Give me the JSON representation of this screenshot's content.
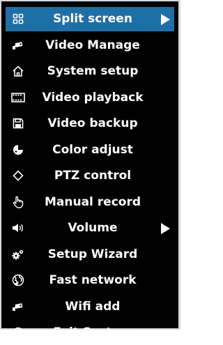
{
  "menu": {
    "selected_color": "#1f6fa7",
    "items": [
      {
        "label": "Split screen",
        "icon": "grid-icon",
        "submenu": true,
        "selected": true
      },
      {
        "label": "Video Manage",
        "icon": "camera-icon",
        "submenu": false,
        "selected": false
      },
      {
        "label": "System setup",
        "icon": "home-icon",
        "submenu": false,
        "selected": false
      },
      {
        "label": "Video playback",
        "icon": "film-icon",
        "submenu": false,
        "selected": false
      },
      {
        "label": "Video backup",
        "icon": "floppy-disk-icon",
        "submenu": false,
        "selected": false
      },
      {
        "label": "Color adjust",
        "icon": "palette-icon",
        "submenu": false,
        "selected": false
      },
      {
        "label": "PTZ control",
        "icon": "diamond-icon",
        "submenu": false,
        "selected": false
      },
      {
        "label": "Manual record",
        "icon": "hand-pointer-icon",
        "submenu": false,
        "selected": false
      },
      {
        "label": "Volume",
        "icon": "speaker-icon",
        "submenu": true,
        "selected": false
      },
      {
        "label": "Setup Wizard",
        "icon": "gears-icon",
        "submenu": false,
        "selected": false
      },
      {
        "label": "Fast network",
        "icon": "globe-icon",
        "submenu": false,
        "selected": false
      },
      {
        "label": "Wifi add",
        "icon": "camera-icon",
        "submenu": false,
        "selected": false
      },
      {
        "label": "Exit System",
        "icon": "power-icon",
        "submenu": false,
        "selected": false
      }
    ]
  }
}
